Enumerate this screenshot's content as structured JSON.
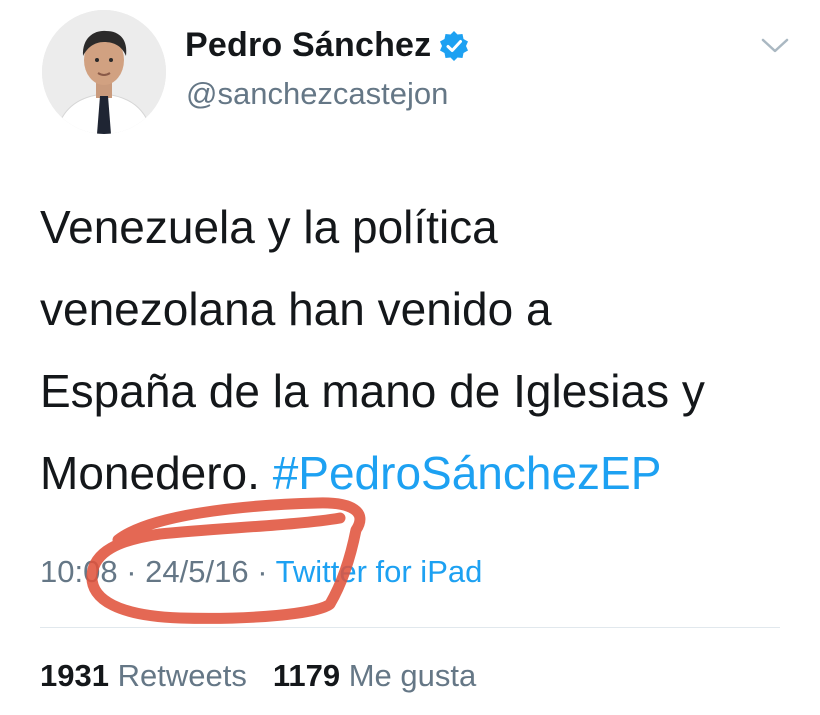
{
  "author": {
    "display_name": "Pedro Sánchez",
    "handle": "@sanchezcastejon",
    "verified": true
  },
  "icons": {
    "verified": "verified-badge-icon",
    "menu": "chevron-down-icon",
    "avatar": "profile-photo"
  },
  "tweet": {
    "text_line1": "Venezuela y la política",
    "text_line2": "venezolana han venido a",
    "text_line3": "España de la mano de Iglesias y",
    "text_line4_plain": "Monedero.",
    "hashtag": "#PedroSánchezEP"
  },
  "meta": {
    "time": "10:08",
    "separator": "·",
    "date": "24/5/16",
    "source": "Twitter for iPad"
  },
  "stats": {
    "retweets_count": "1931",
    "retweets_label": "Retweets",
    "likes_count": "1179",
    "likes_label": "Me gusta"
  },
  "colors": {
    "link": "#1da1f2",
    "secondary_text": "#657786",
    "primary_text": "#14171a",
    "verified": "#1da1f2",
    "annotation": "#e0533c"
  }
}
